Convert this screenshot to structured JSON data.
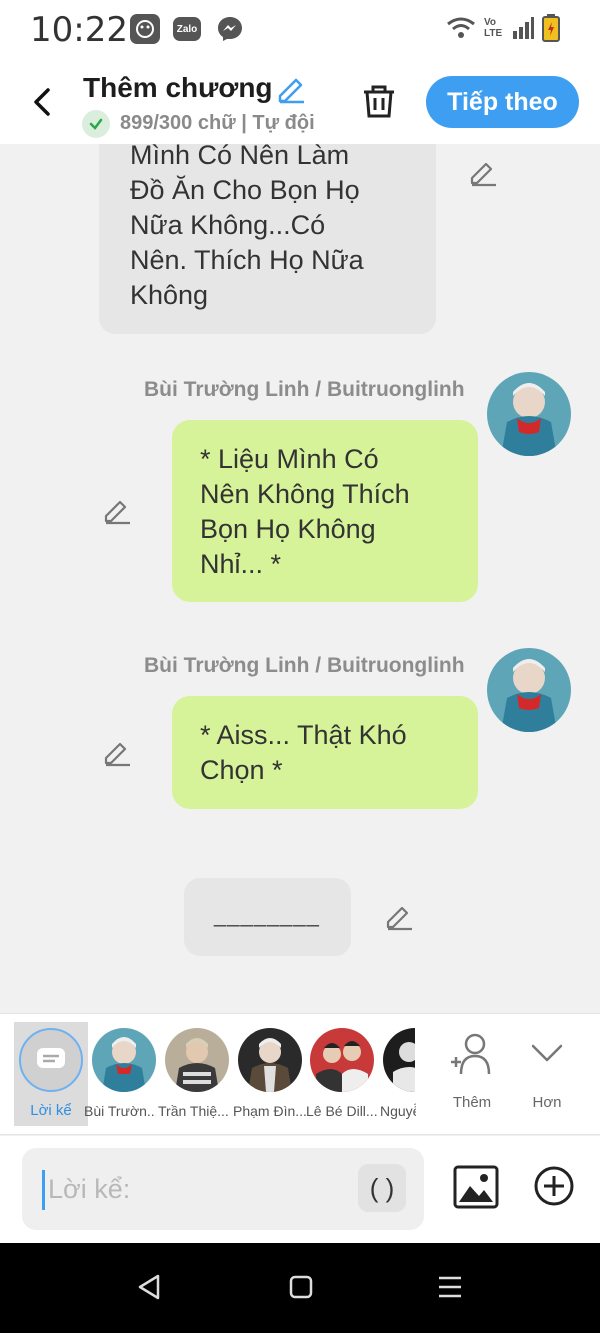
{
  "status_bar": {
    "time": "10:22",
    "icons": [
      "notification-app-icon",
      "zalo-icon",
      "messenger-icon"
    ],
    "zalo_text": "Zalo",
    "right_icons": [
      "wifi-icon",
      "volte-icon",
      "signal-icon",
      "battery-icon"
    ],
    "volte_text": "Vo LTE"
  },
  "header": {
    "title": "Thêm chương",
    "subtitle": "899/300 chữ | Tự đội",
    "next_label": "Tiếp theo"
  },
  "chat": {
    "partial_message": {
      "lines": [
        "Mình Có Nên Làm",
        "Đồ Ăn Cho Bọn Họ",
        "Nữa Không...Có",
        "Nên. Thích Họ Nữa",
        "Không"
      ]
    },
    "messages": [
      {
        "sender": "Bùi Trường Linh / Buitruonglinh",
        "lines": [
          "* Liệu Mình Có",
          "Nên Không Thích",
          "Bọn Họ Không",
          "Nhỉ... *"
        ]
      },
      {
        "sender": "Bùi Trường Linh / Buitruonglinh",
        "lines": [
          "* Aiss... Thật Khó",
          "Chọn *"
        ]
      }
    ],
    "divider_text": "________"
  },
  "characters": {
    "narrator_label": "Lời kể",
    "items": [
      {
        "name": "Bùi Trườn..."
      },
      {
        "name": "Trần Thiệ..."
      },
      {
        "name": "Phạm Đìn..."
      },
      {
        "name": "Lê Bé Dill..."
      },
      {
        "name": "Nguyễ..."
      }
    ],
    "add_label": "Thêm",
    "more_label": "Hơn"
  },
  "input": {
    "placeholder": "Lời kể:",
    "paren_label": "( )"
  },
  "colors": {
    "accent": "#3d9ef2",
    "bubble_green": "#d6f39a",
    "bubble_gray": "#e6e6e6"
  }
}
